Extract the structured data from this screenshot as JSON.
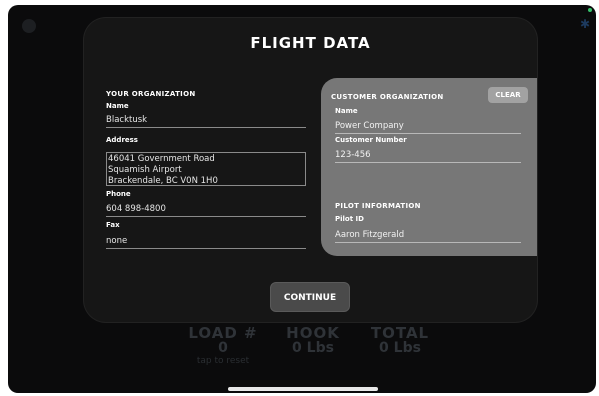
{
  "background": {
    "stats": [
      {
        "label": "LOAD #",
        "value": "0",
        "hint": "tap to reset"
      },
      {
        "label": "HOOK",
        "value": "0 Lbs",
        "hint": ""
      },
      {
        "label": "TOTAL",
        "value": "0 Lbs",
        "hint": ""
      }
    ]
  },
  "modal": {
    "title": "FLIGHT DATA",
    "your_org": {
      "section_title": "YOUR ORGANIZATION",
      "name_label": "Name",
      "name_value": "Blacktusk",
      "address_label": "Address",
      "address_lines": [
        "46041 Government Road",
        "Squamish Airport",
        "Brackendale, BC V0N 1H0"
      ],
      "phone_label": "Phone",
      "phone_value": "604 898-4800",
      "fax_label": "Fax",
      "fax_value": "none"
    },
    "customer_org": {
      "section_title": "CUSTOMER ORGANIZATION",
      "clear_label": "CLEAR",
      "name_label": "Name",
      "name_value": "Power Company",
      "customer_number_label": "Customer Number",
      "customer_number_value": "123-456"
    },
    "pilot": {
      "section_title": "PILOT INFORMATION",
      "pilot_id_label": "Pilot ID",
      "pilot_id_value": "Aaron Fitzgerald"
    },
    "continue_label": "CONTINUE"
  }
}
